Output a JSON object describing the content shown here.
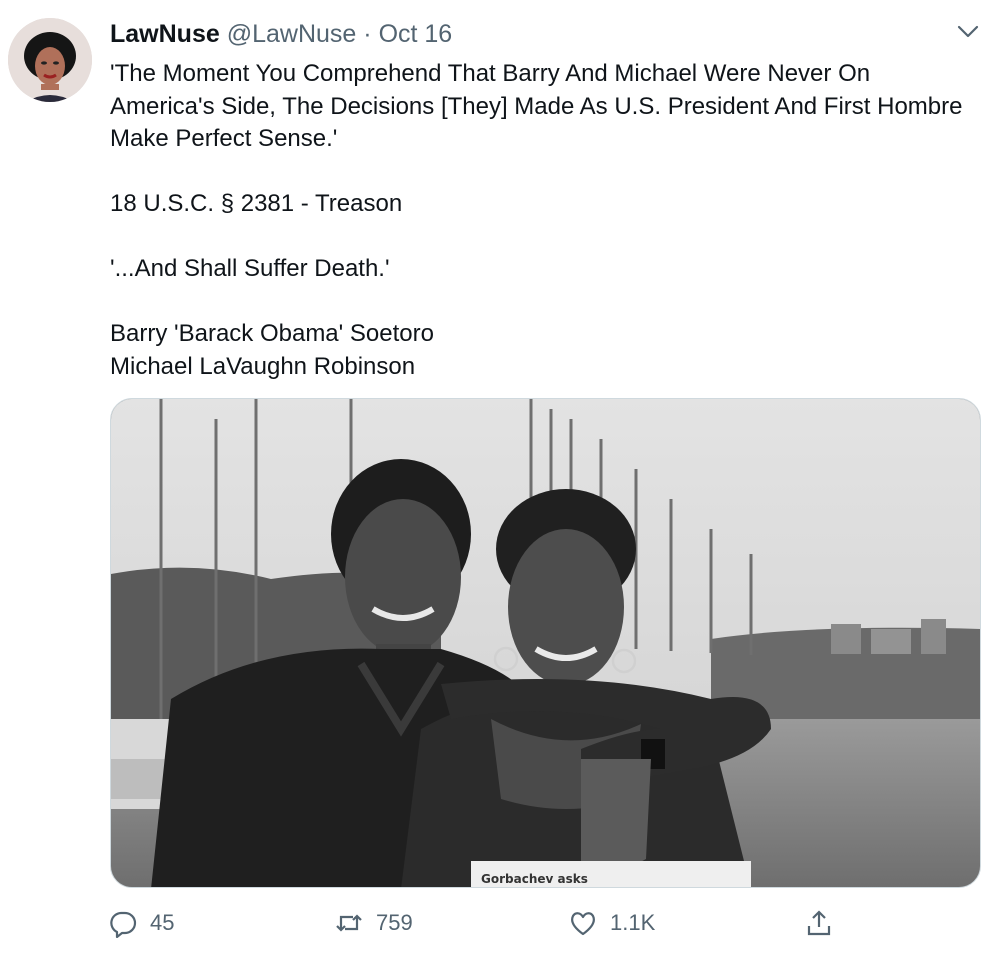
{
  "tweet": {
    "display_name": "LawNuse",
    "handle": "@LawNuse",
    "separator": "·",
    "date": "Oct 16",
    "avatar_icon": "profile-photo-avatar",
    "menu_icon": "chevron-down-icon",
    "text": {
      "line1": "'The Moment You Comprehend That Barry And Michael Were Never On America's Side, The Decisions [They] Made As U.S. President And First Hombre Make Perfect Sense.'",
      "line2": "18 U.S.C. § 2381 - Treason",
      "line3": "'...And Shall Suffer Death.'",
      "line4": "Barry 'Barack Obama' Soetoro",
      "line5": "Michael LaVaughn Robinson"
    },
    "media": {
      "newspaper_text": "Gorbachev asks"
    },
    "actions": {
      "reply_count": "45",
      "retweet_count": "759",
      "like_count": "1.1K",
      "reply_icon": "reply-icon",
      "retweet_icon": "retweet-icon",
      "like_icon": "heart-icon",
      "share_icon": "share-icon"
    },
    "colors": {
      "text": "#0f1419",
      "secondary": "#536471",
      "border": "#cfd9de"
    }
  }
}
